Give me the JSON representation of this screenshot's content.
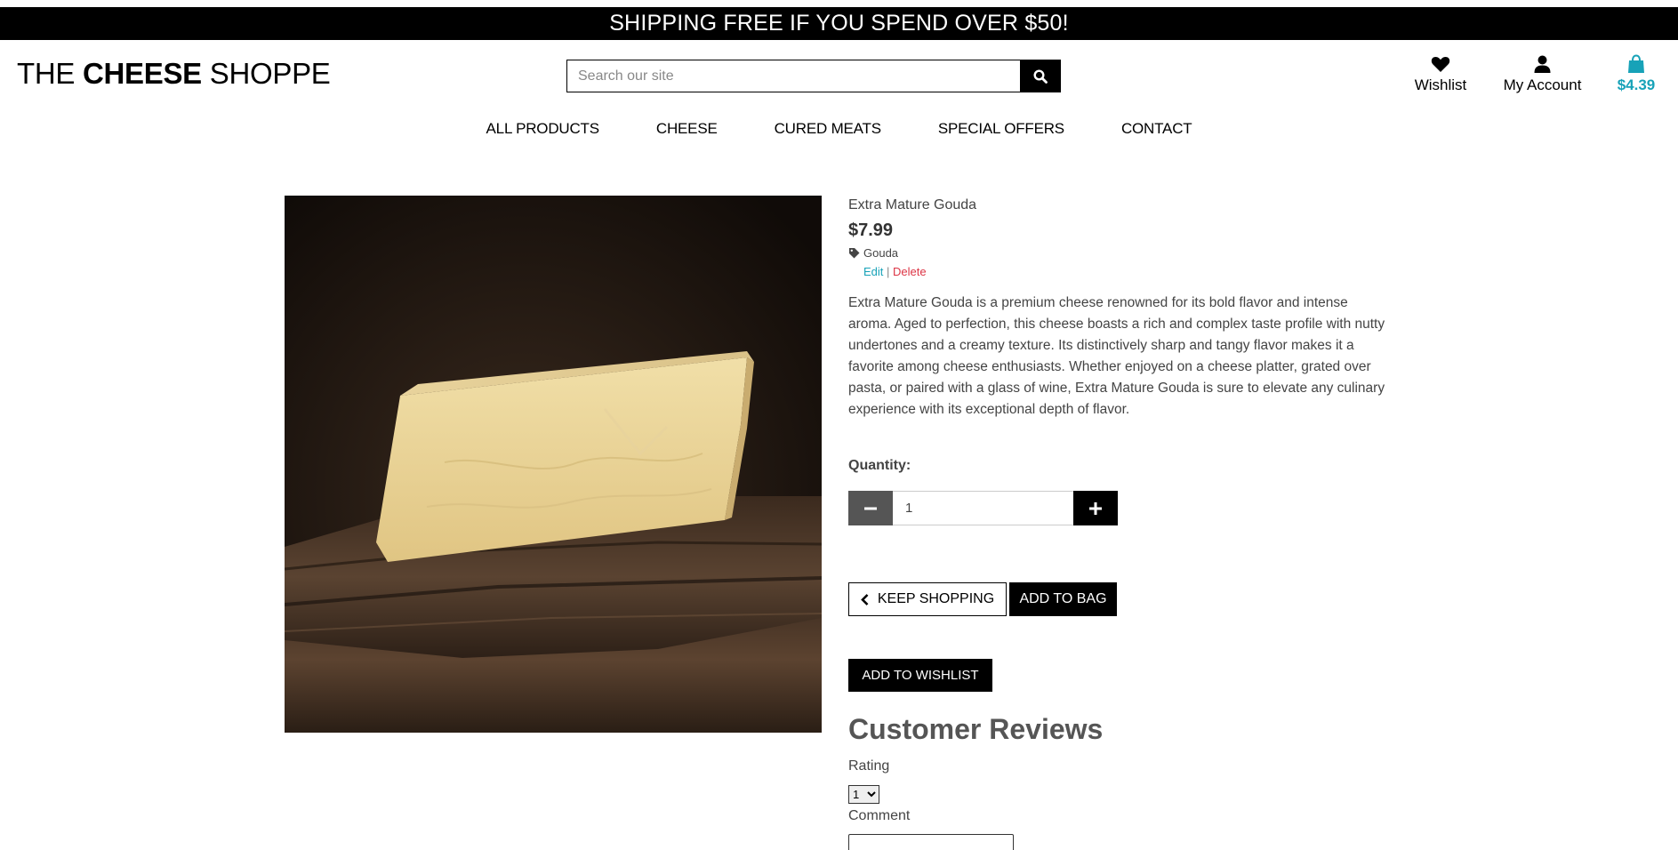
{
  "banner": {
    "text": "SHIPPING FREE IF YOU SPEND OVER $50!"
  },
  "logo": {
    "part1": "THE ",
    "part2": "CHEESE",
    "part3": " SHOPPE"
  },
  "search": {
    "placeholder": "Search our site",
    "icon": "search-icon"
  },
  "header_links": {
    "wishlist": {
      "label": "Wishlist",
      "icon": "heart-icon"
    },
    "account": {
      "label": "My Account",
      "icon": "user-icon"
    },
    "bag": {
      "label": "$4.39",
      "icon": "shopping-bag-icon",
      "color": "#17a2b8"
    }
  },
  "nav": {
    "items": [
      "ALL PRODUCTS",
      "CHEESE",
      "CURED MEATS",
      "SPECIAL OFFERS",
      "CONTACT"
    ]
  },
  "product": {
    "name": "Extra Mature Gouda",
    "price": "$7.99",
    "category": "Gouda",
    "category_icon": "tag-icon",
    "edit_label": "Edit",
    "separator": "|",
    "delete_label": "Delete",
    "description": "Extra Mature Gouda is a premium cheese renowned for its bold flavor and intense aroma. Aged to perfection, this cheese boasts a rich and complex taste profile with nutty undertones and a creamy texture. Its distinctively sharp and tangy flavor makes it a favorite among cheese enthusiasts. Whether enjoyed on a cheese platter, grated over pasta, or paired with a glass of wine, Extra Mature Gouda is sure to elevate any culinary experience with its exceptional depth of flavor."
  },
  "quantity": {
    "label": "Quantity:",
    "value": "1"
  },
  "buttons": {
    "keep_shopping": "KEEP SHOPPING",
    "add_to_bag": "ADD TO BAG",
    "add_to_wishlist": "ADD TO WISHLIST"
  },
  "reviews": {
    "title": "Customer Reviews",
    "rating_label": "Rating",
    "rating_value": "1",
    "comment_label": "Comment"
  },
  "colors": {
    "accent": "#17a2b8",
    "danger": "#dc3545",
    "dark": "#000000"
  }
}
